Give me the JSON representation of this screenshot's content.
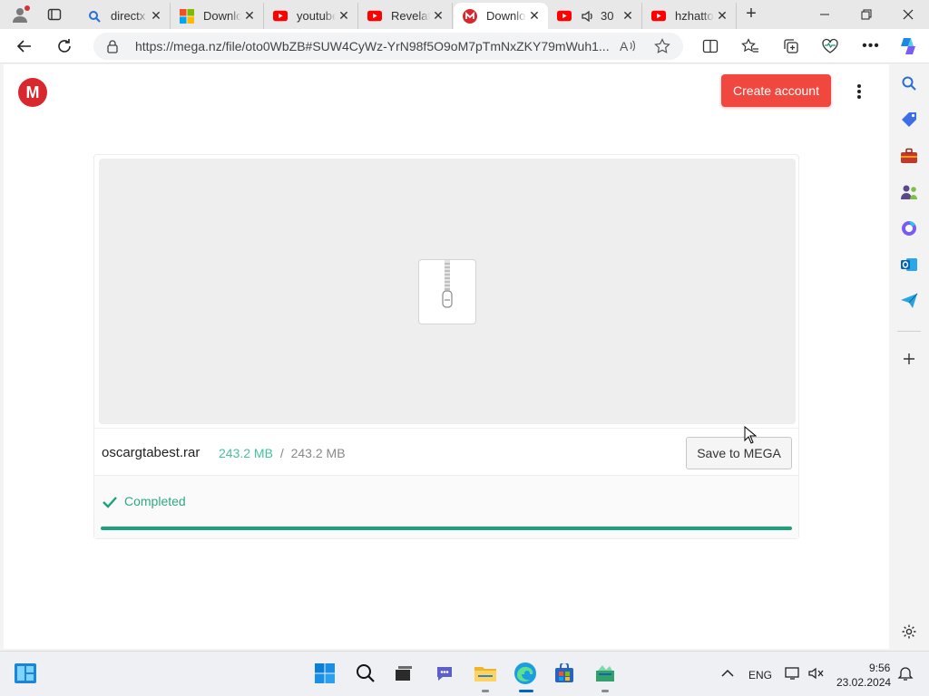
{
  "browser": {
    "tabs": [
      {
        "label": "directx",
        "icon": "search-icon"
      },
      {
        "label": "Download",
        "icon": "microsoft-icon"
      },
      {
        "label": "youtube",
        "icon": "youtube-icon"
      },
      {
        "label": "Revelation",
        "icon": "youtube-icon"
      },
      {
        "label": "Download",
        "icon": "mega-icon",
        "active": true
      },
      {
        "label": "30",
        "icon": "youtube-icon",
        "audio": true
      },
      {
        "label": "hzhatto",
        "icon": "youtube-icon"
      }
    ],
    "url": "https://mega.nz/file/oto0WbZB#SUW4CyWz-YrN98f5O9oM7pTmNxZKY79mWuh1..."
  },
  "header": {
    "logo_letter": "M",
    "create_account_label": "Create account"
  },
  "file": {
    "name": "oscargtabest.rar",
    "downloaded": "243.2 MB",
    "separator": "/",
    "total": "243.2 MB",
    "save_label": "Save to MEGA",
    "status": "Completed",
    "progress": 1.0
  },
  "taskbar": {
    "language": "ENG",
    "time": "9:56",
    "date": "23.02.2024"
  },
  "colors": {
    "mega_red": "#d9272e",
    "create_button": "#f0483e",
    "progress_green": "#1aa37a",
    "status_green": "#2fa883"
  }
}
